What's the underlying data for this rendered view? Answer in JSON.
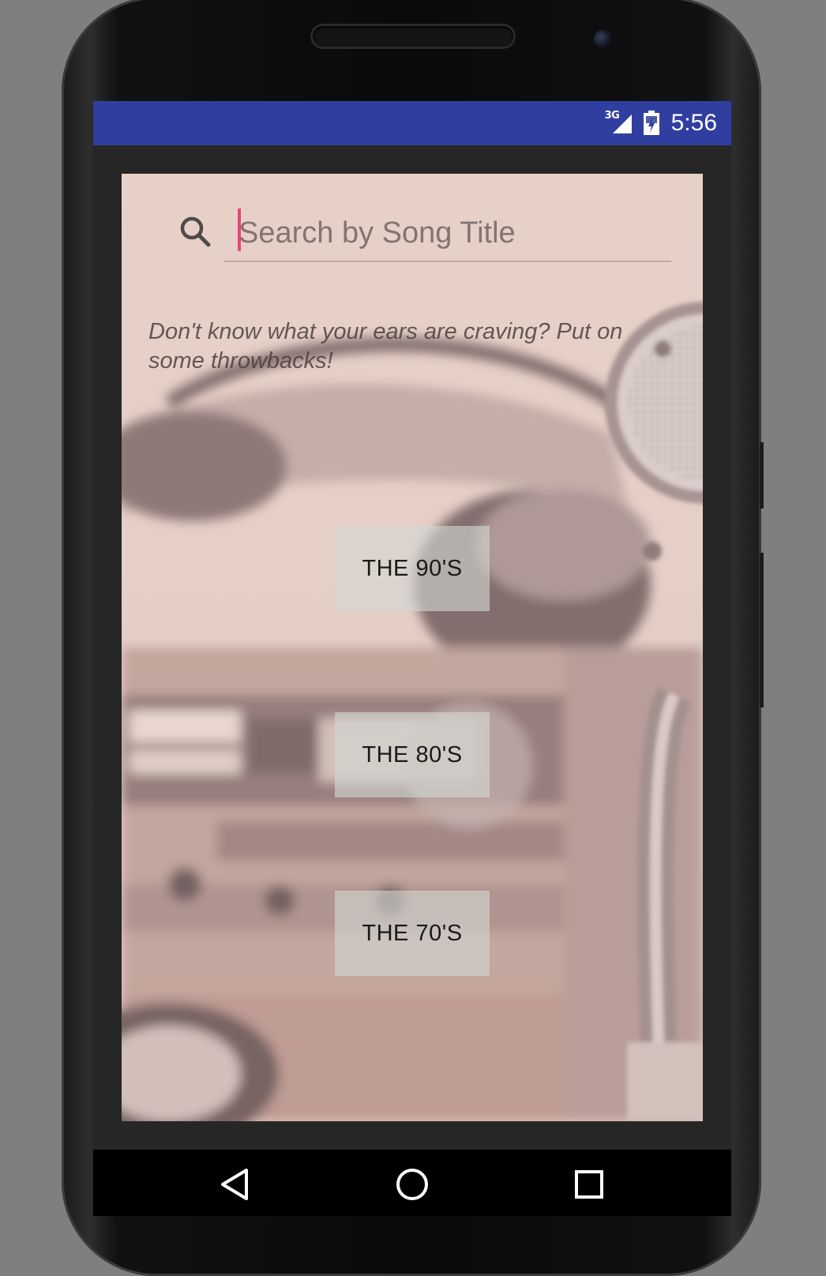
{
  "status_bar": {
    "network": "3G",
    "time": "5:56",
    "colors": {
      "background": "#303f9f"
    }
  },
  "search": {
    "placeholder": "Search by Song Title",
    "value": "",
    "icon": "search-icon"
  },
  "tagline": "Don't know what your ears are craving? Put on some throwbacks!",
  "decades": [
    {
      "label": "THE 90'S"
    },
    {
      "label": "THE 80'S"
    },
    {
      "label": "THE 70'S"
    }
  ],
  "nav_bar": {
    "buttons": [
      "back-icon",
      "home-icon",
      "recents-icon"
    ]
  },
  "colors": {
    "accent": "#e8457a",
    "button_bg": "#d2d7d2"
  }
}
